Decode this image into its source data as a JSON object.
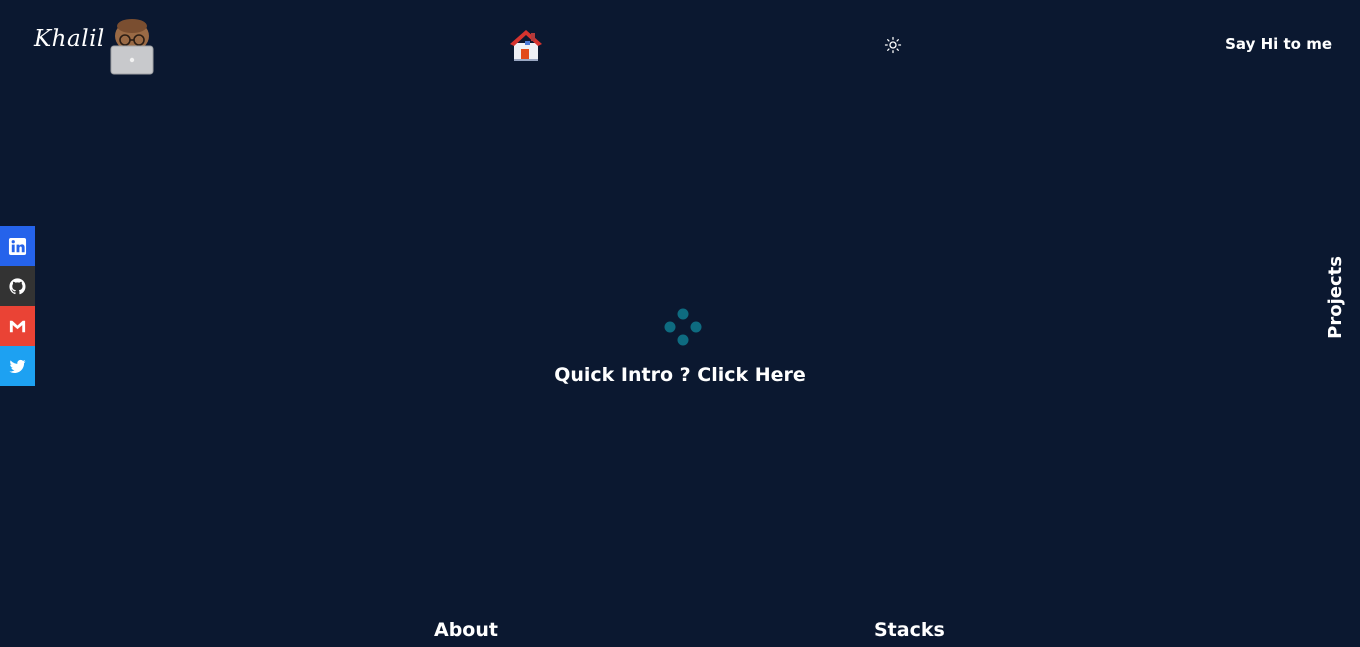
{
  "header": {
    "logo_text": "Khalil",
    "avatar_icon": "memoji-laptop-icon",
    "home_icon": "house-icon",
    "theme_icon": "sun-icon",
    "say_hi": "Say Hi to me"
  },
  "social": {
    "items": [
      {
        "icon": "linkedin-icon",
        "color": "#2563eb"
      },
      {
        "icon": "github-icon",
        "color": "#333333"
      },
      {
        "icon": "gmail-icon",
        "color": "#ea4335"
      },
      {
        "icon": "twitter-icon",
        "color": "#1da1f2"
      }
    ]
  },
  "side_nav": {
    "projects": "Projects"
  },
  "main": {
    "intro_text": "Quick Intro ? Click Here",
    "loader_color": "#0e6b80"
  },
  "bottom_nav": {
    "about": "About",
    "stacks": "Stacks"
  },
  "colors": {
    "background": "#0b1830",
    "text": "#ffffff"
  }
}
